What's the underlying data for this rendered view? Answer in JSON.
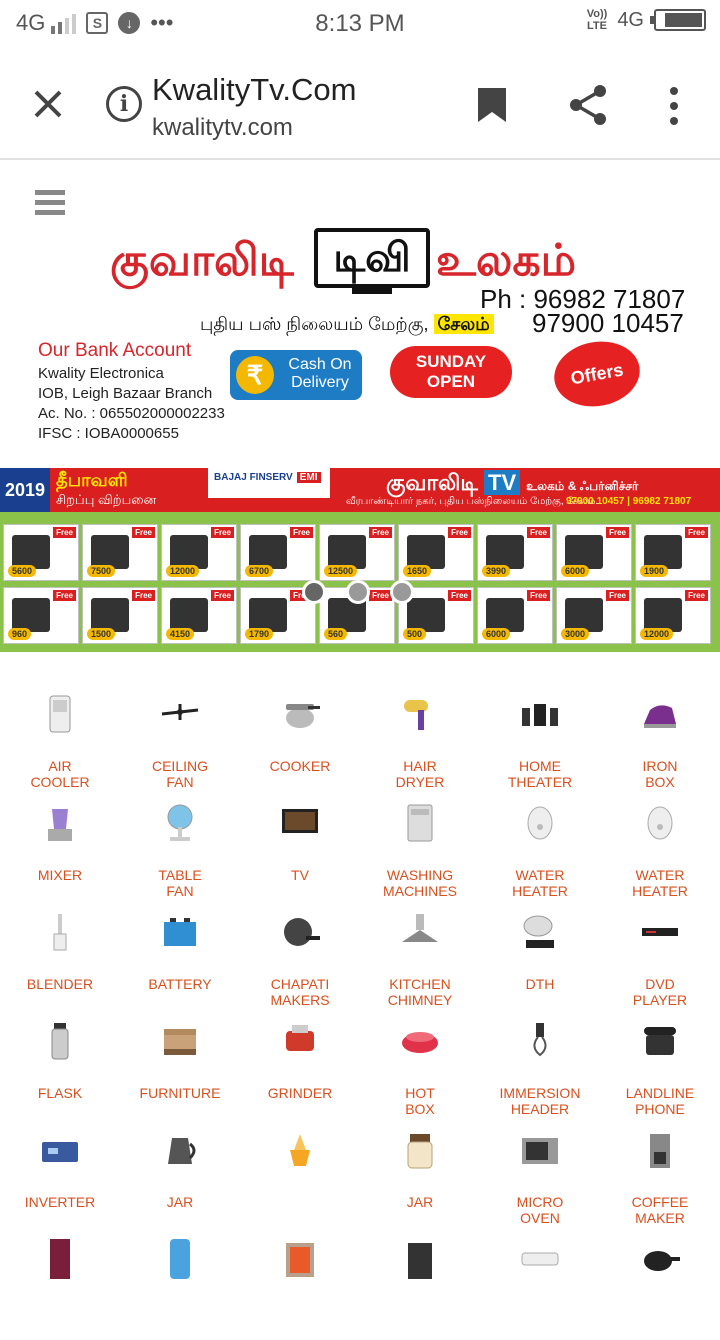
{
  "status_bar": {
    "network": "4G",
    "time": "8:13 PM",
    "volte": "Vo)) LTE",
    "network_right": "4G",
    "battery_level": 0.85
  },
  "toolbar": {
    "title": "KwalityTv.Com",
    "url": "kwalitytv.com"
  },
  "header_banner": {
    "title_part1": "குவாலிடி",
    "title_tv": "டிவி",
    "title_part3": "உலகம்",
    "phone_label": "Ph : 96982 71807",
    "phone_2": "97900 10457",
    "address": "புதிய பஸ் நிலையம் மேற்கு,",
    "city": "சேலம்",
    "bank_heading": "Our Bank Account",
    "bank_name": "Kwality Electronica",
    "bank_branch": "IOB, Leigh Bazaar Branch",
    "bank_acno": "Ac. No. : 065502000002233",
    "bank_ifsc": "IFSC : IOBA0000655",
    "cod_label": "Cash On Delivery",
    "rupee": "₹",
    "sunday_label": "SUNDAY OPEN",
    "offers_label": "Offers"
  },
  "offer_banner": {
    "year": "2019",
    "festival": "தீபாவளி",
    "festival_sub": "சிறப்பு விற்பனை",
    "bajaj": "BAJAJ FINSERV",
    "emi": "EMI",
    "brand": "குவாலிடி",
    "brand_tv": "TV",
    "brand_suffix": "உலகம் & ஃபர்னிச்சர்",
    "address": "வீரபாண்டியார் நகர், புதிய பஸ்நிலையம் மேற்கு, சேலம்.",
    "phones": "97900 10457 | 96982 71807",
    "free_label": "Free",
    "tiles": [
      {
        "price": "5600"
      },
      {
        "price": "7500"
      },
      {
        "price": "12000"
      },
      {
        "price": "6700"
      },
      {
        "price": "12500"
      },
      {
        "price": "1650"
      },
      {
        "price": "3990"
      },
      {
        "price": "6000"
      },
      {
        "price": "1900"
      },
      {
        "price": "960"
      },
      {
        "price": "1500"
      },
      {
        "price": "4150"
      },
      {
        "price": "1790"
      },
      {
        "price": "560"
      },
      {
        "price": "500"
      },
      {
        "price": "6000"
      },
      {
        "price": "3000"
      },
      {
        "price": "12000"
      }
    ]
  },
  "categories": [
    {
      "label": "AIR\nCOOLER",
      "icon": "air-cooler-icon"
    },
    {
      "label": "CEILING\nFAN",
      "icon": "ceiling-fan-icon"
    },
    {
      "label": "COOKER",
      "icon": "cooker-icon"
    },
    {
      "label": "HAIR\nDRYER",
      "icon": "hair-dryer-icon"
    },
    {
      "label": "HOME\nTHEATER",
      "icon": "home-theater-icon"
    },
    {
      "label": "IRON\nBOX",
      "icon": "iron-box-icon"
    },
    {
      "label": "MIXER",
      "icon": "mixer-icon"
    },
    {
      "label": "TABLE\nFAN",
      "icon": "table-fan-icon"
    },
    {
      "label": "TV",
      "icon": "tv-icon"
    },
    {
      "label": "WASHING\nMACHINES",
      "icon": "washing-machine-icon"
    },
    {
      "label": "WATER\nHEATER",
      "icon": "water-heater-icon"
    },
    {
      "label": "WATER\nHEATER",
      "icon": "water-heater-icon"
    },
    {
      "label": "BLENDER",
      "icon": "blender-icon"
    },
    {
      "label": "BATTERY",
      "icon": "battery-icon"
    },
    {
      "label": "CHAPATI\nMAKERS",
      "icon": "chapati-maker-icon"
    },
    {
      "label": "KITCHEN\nCHIMNEY",
      "icon": "kitchen-chimney-icon"
    },
    {
      "label": "DTH",
      "icon": "dth-icon"
    },
    {
      "label": "DVD\nPLAYER",
      "icon": "dvd-player-icon"
    },
    {
      "label": "FLASK",
      "icon": "flask-icon"
    },
    {
      "label": "FURNITURE",
      "icon": "furniture-icon"
    },
    {
      "label": "GRINDER",
      "icon": "grinder-icon"
    },
    {
      "label": "HOT\nBOX",
      "icon": "hot-box-icon"
    },
    {
      "label": "IMMERSION\nHEADER",
      "icon": "immersion-heater-icon"
    },
    {
      "label": "LANDLINE\nPHONE",
      "icon": "landline-phone-icon"
    },
    {
      "label": "INVERTER",
      "icon": "inverter-icon"
    },
    {
      "label": "JAR",
      "icon": "kettle-icon"
    },
    {
      "label": "",
      "icon": "juicer-icon"
    },
    {
      "label": "JAR",
      "icon": "jar-icon"
    },
    {
      "label": "MICRO\nOVEN",
      "icon": "micro-oven-icon"
    },
    {
      "label": "COFFEE\nMAKER",
      "icon": "coffee-maker-icon"
    },
    {
      "label": "",
      "icon": "refrigerator-icon"
    },
    {
      "label": "",
      "icon": "water-purifier-icon"
    },
    {
      "label": "",
      "icon": "room-heater-icon"
    },
    {
      "label": "",
      "icon": "speaker-icon"
    },
    {
      "label": "",
      "icon": "air-conditioner-icon"
    },
    {
      "label": "",
      "icon": "pan-icon"
    }
  ]
}
